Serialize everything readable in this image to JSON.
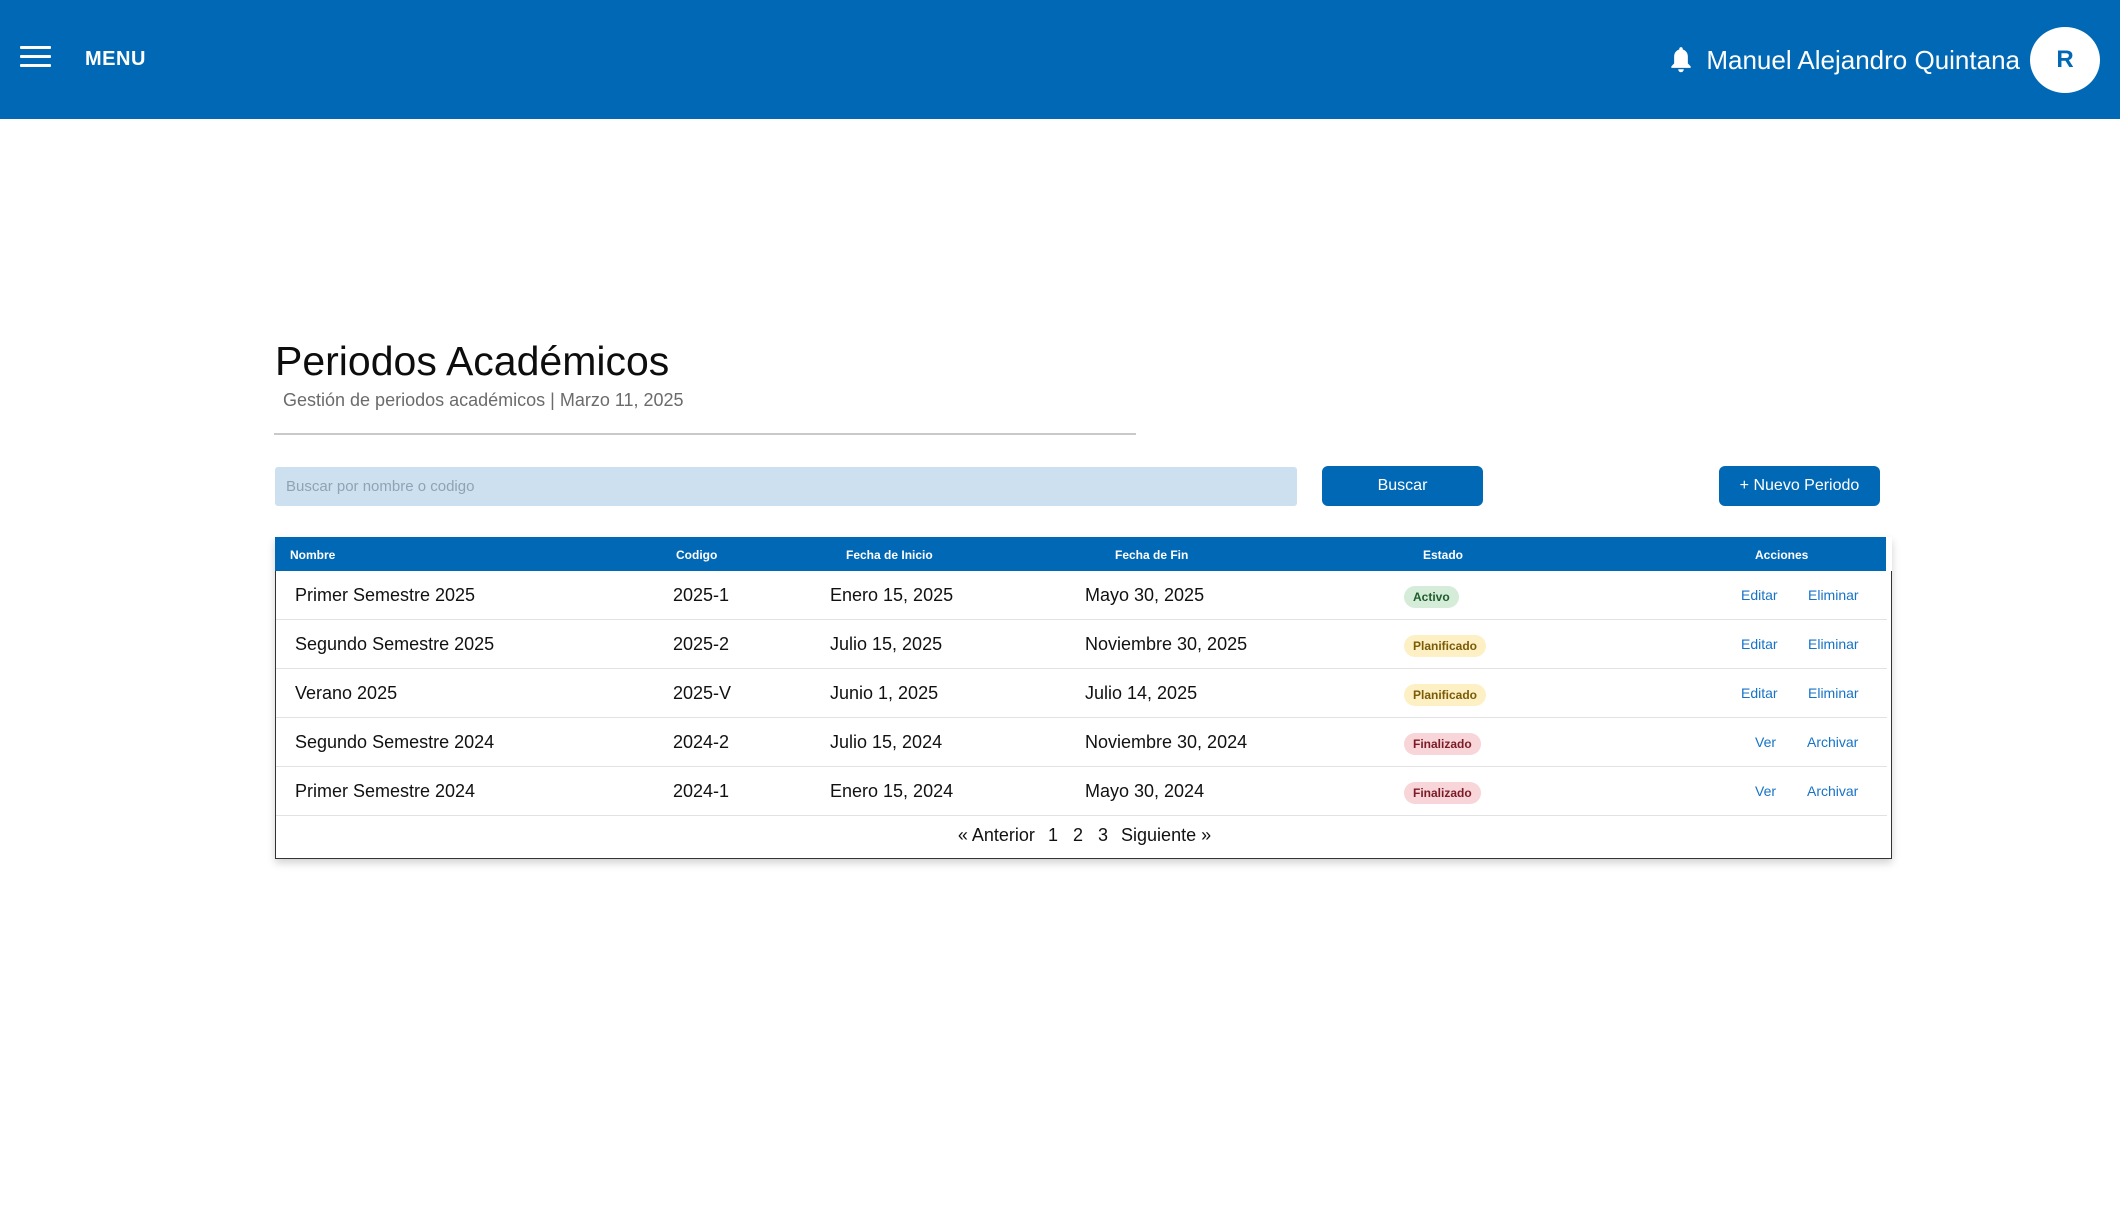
{
  "topbar": {
    "menu_label": "MENU",
    "user_name": "Manuel Alejandro Quintana",
    "avatar_initial": "R",
    "color": "#0168b5"
  },
  "header": {
    "title": "Periodos Académicos",
    "subtitle": "Gestión de periodos académicos | Marzo 11, 2025"
  },
  "toolbar": {
    "search_placeholder": "Buscar por nombre o codigo",
    "search_value": "",
    "search_button": "Buscar",
    "new_button": "+ Nuevo Periodo"
  },
  "table": {
    "columns": [
      "Nombre",
      "Codigo",
      "Fecha de Inicio",
      "Fecha de Fin",
      "Estado",
      "Acciones"
    ],
    "rows": [
      {
        "nombre": "Primer Semestre 2025",
        "codigo": "2025-1",
        "inicio": "Enero 15, 2025",
        "fin": "Mayo 30, 2025",
        "estado": "Activo",
        "acciones": [
          "Editar",
          "Eliminar"
        ]
      },
      {
        "nombre": "Segundo Semestre 2025",
        "codigo": "2025-2",
        "inicio": "Julio 15, 2025",
        "fin": "Noviembre 30, 2025",
        "estado": "Planificado",
        "acciones": [
          "Editar",
          "Eliminar"
        ]
      },
      {
        "nombre": "Verano 2025",
        "codigo": "2025-V",
        "inicio": "Junio 1, 2025",
        "fin": "Julio 14, 2025",
        "estado": "Planificado",
        "acciones": [
          "Editar",
          "Eliminar"
        ]
      },
      {
        "nombre": "Segundo Semestre 2024",
        "codigo": "2024-2",
        "inicio": "Julio 15, 2024",
        "fin": "Noviembre 30, 2024",
        "estado": "Finalizado",
        "acciones": [
          "Ver",
          "Archivar"
        ]
      },
      {
        "nombre": "Primer Semestre 2024",
        "codigo": "2024-1",
        "inicio": "Enero 15, 2024",
        "fin": "Mayo 30, 2024",
        "estado": "Finalizado",
        "acciones": [
          "Ver",
          "Archivar"
        ]
      }
    ],
    "status_colors": {
      "Activo": {
        "bg": "#d5ecd9",
        "fg": "#1f5d2c"
      },
      "Planificado": {
        "bg": "#fdf0c4",
        "fg": "#7a5b06"
      },
      "Finalizado": {
        "bg": "#f7d5d8",
        "fg": "#7c1b26"
      }
    }
  },
  "pagination": {
    "prev": "« Anterior",
    "pages": [
      "1",
      "2",
      "3"
    ],
    "next": "Siguiente »"
  },
  "icons": [
    "menu-icon",
    "bell-icon"
  ]
}
